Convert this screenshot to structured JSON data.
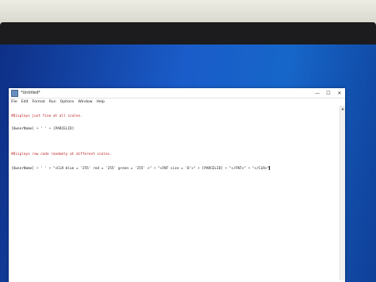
{
  "window": {
    "title": "*Untitled*",
    "controls": {
      "minimize": "—",
      "maximize": "☐",
      "close": "✕"
    }
  },
  "menu": [
    "File",
    "Edit",
    "Format",
    "Run",
    "Options",
    "Window",
    "Help"
  ],
  "editor": {
    "lines": [
      "#Displays just fine at all scales.",
      "[OwnerName] + ' ' + [PARCELID]",
      "",
      "#Displays raw code randomly at different scales.",
      "[OwnerName] + ' ' + \"<CLR blue = '255' red = '255' green = '255' >\" + \"<FNT size = '8'>\" + [PARCELID] + \"</FNT>\" + \"</CLR>\""
    ]
  },
  "scrollbar": {
    "up_arrow": "▲"
  },
  "colors": {
    "desktop": "#1a5cc9",
    "comment": "#b8191b",
    "string": "#1f8a1f",
    "text": "#222222"
  }
}
